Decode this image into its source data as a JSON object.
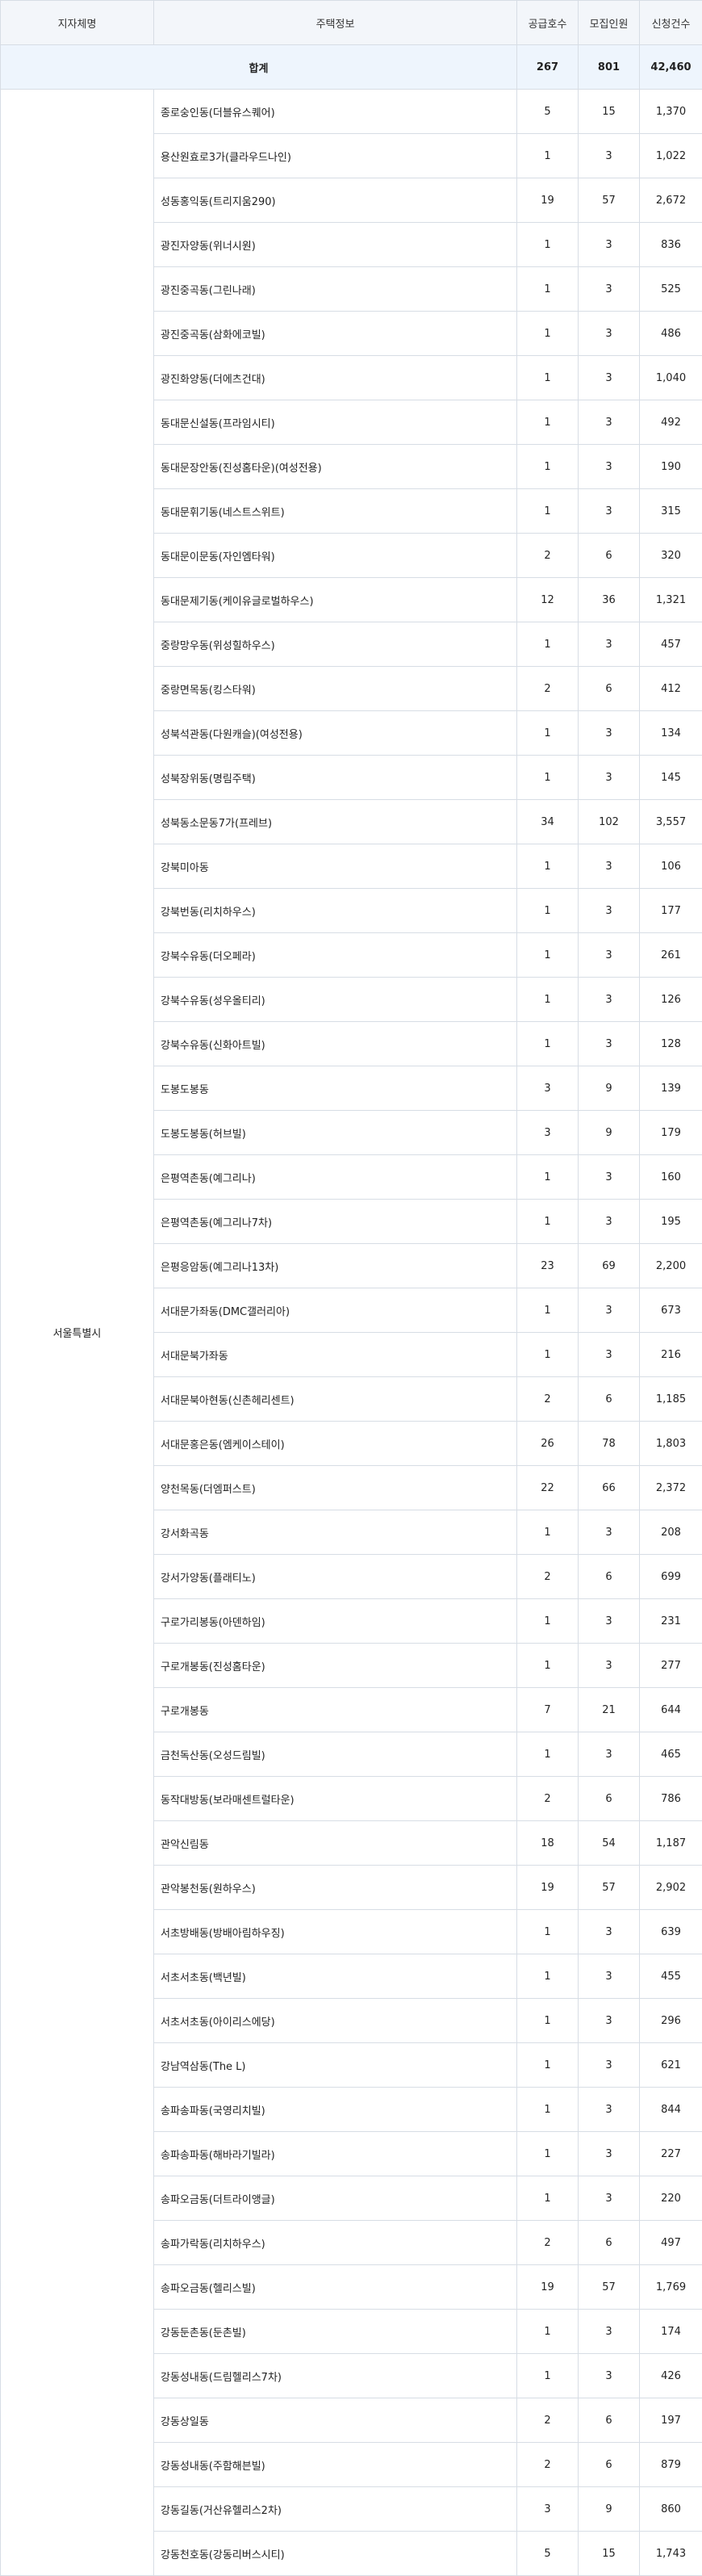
{
  "table": {
    "headers": [
      "지자체명",
      "주택정보",
      "공급호수",
      "모집인원",
      "신청건수"
    ],
    "total": {
      "label": "합계",
      "supply": "267",
      "recruit": "801",
      "applications": "42,460"
    },
    "region": "서울특별시",
    "rows": [
      {
        "name": "종로숭인동(더블유스퀘어)",
        "supply": "5",
        "recruit": "15",
        "applications": "1,370"
      },
      {
        "name": "용산원효로3가(클라우드나인)",
        "supply": "1",
        "recruit": "3",
        "applications": "1,022"
      },
      {
        "name": "성동홍익동(트리지움290)",
        "supply": "19",
        "recruit": "57",
        "applications": "2,672"
      },
      {
        "name": "광진자양동(위너시원)",
        "supply": "1",
        "recruit": "3",
        "applications": "836"
      },
      {
        "name": "광진중곡동(그린나래)",
        "supply": "1",
        "recruit": "3",
        "applications": "525"
      },
      {
        "name": "광진중곡동(삼화에코빌)",
        "supply": "1",
        "recruit": "3",
        "applications": "486"
      },
      {
        "name": "광진화양동(더에츠건대)",
        "supply": "1",
        "recruit": "3",
        "applications": "1,040"
      },
      {
        "name": "동대문신설동(프라임시티)",
        "supply": "1",
        "recruit": "3",
        "applications": "492"
      },
      {
        "name": "동대문장안동(진성홈타운)(여성전용)",
        "supply": "1",
        "recruit": "3",
        "applications": "190"
      },
      {
        "name": "동대문휘기동(네스트스위트)",
        "supply": "1",
        "recruit": "3",
        "applications": "315"
      },
      {
        "name": "동대문이문동(자인엠타워)",
        "supply": "2",
        "recruit": "6",
        "applications": "320"
      },
      {
        "name": "동대문제기동(케이유글로벌하우스)",
        "supply": "12",
        "recruit": "36",
        "applications": "1,321"
      },
      {
        "name": "중랑망우동(위성힐하우스)",
        "supply": "1",
        "recruit": "3",
        "applications": "457"
      },
      {
        "name": "중랑면목동(킹스타워)",
        "supply": "2",
        "recruit": "6",
        "applications": "412"
      },
      {
        "name": "성북석관동(다원캐슬)(여성전용)",
        "supply": "1",
        "recruit": "3",
        "applications": "134"
      },
      {
        "name": "성북장위동(명림주택)",
        "supply": "1",
        "recruit": "3",
        "applications": "145"
      },
      {
        "name": "성북동소문동7가(프레브)",
        "supply": "34",
        "recruit": "102",
        "applications": "3,557"
      },
      {
        "name": "강북미아동",
        "supply": "1",
        "recruit": "3",
        "applications": "106"
      },
      {
        "name": "강북번동(리치하우스)",
        "supply": "1",
        "recruit": "3",
        "applications": "177"
      },
      {
        "name": "강북수유동(더오페라)",
        "supply": "1",
        "recruit": "3",
        "applications": "261"
      },
      {
        "name": "강북수유동(성우올티리)",
        "supply": "1",
        "recruit": "3",
        "applications": "126"
      },
      {
        "name": "강북수유동(신화아트빌)",
        "supply": "1",
        "recruit": "3",
        "applications": "128"
      },
      {
        "name": "도봉도봉동",
        "supply": "3",
        "recruit": "9",
        "applications": "139"
      },
      {
        "name": "도봉도봉동(허브빌)",
        "supply": "3",
        "recruit": "9",
        "applications": "179"
      },
      {
        "name": "은평역촌동(예그리나)",
        "supply": "1",
        "recruit": "3",
        "applications": "160"
      },
      {
        "name": "은평역촌동(예그리나7차)",
        "supply": "1",
        "recruit": "3",
        "applications": "195"
      },
      {
        "name": "은평응암동(예그리나13차)",
        "supply": "23",
        "recruit": "69",
        "applications": "2,200"
      },
      {
        "name": "서대문가좌동(DMC갤러리아)",
        "supply": "1",
        "recruit": "3",
        "applications": "673"
      },
      {
        "name": "서대문북가좌동",
        "supply": "1",
        "recruit": "3",
        "applications": "216"
      },
      {
        "name": "서대문북아현동(신촌헤리센트)",
        "supply": "2",
        "recruit": "6",
        "applications": "1,185"
      },
      {
        "name": "서대문홍은동(엠케이스테이)",
        "supply": "26",
        "recruit": "78",
        "applications": "1,803"
      },
      {
        "name": "양천목동(더엠퍼스트)",
        "supply": "22",
        "recruit": "66",
        "applications": "2,372"
      },
      {
        "name": "강서화곡동",
        "supply": "1",
        "recruit": "3",
        "applications": "208"
      },
      {
        "name": "강서가양동(플래티노)",
        "supply": "2",
        "recruit": "6",
        "applications": "699"
      },
      {
        "name": "구로가리봉동(아덴하임)",
        "supply": "1",
        "recruit": "3",
        "applications": "231"
      },
      {
        "name": "구로개봉동(진성홈타운)",
        "supply": "1",
        "recruit": "3",
        "applications": "277"
      },
      {
        "name": "구로개봉동",
        "supply": "7",
        "recruit": "21",
        "applications": "644"
      },
      {
        "name": "금천독산동(오성드림빌)",
        "supply": "1",
        "recruit": "3",
        "applications": "465"
      },
      {
        "name": "동작대방동(보라매센트럴타운)",
        "supply": "2",
        "recruit": "6",
        "applications": "786"
      },
      {
        "name": "관악신림동",
        "supply": "18",
        "recruit": "54",
        "applications": "1,187"
      },
      {
        "name": "관악봉천동(원하우스)",
        "supply": "19",
        "recruit": "57",
        "applications": "2,902"
      },
      {
        "name": "서초방배동(방배아림하우징)",
        "supply": "1",
        "recruit": "3",
        "applications": "639"
      },
      {
        "name": "서초서초동(백년빌)",
        "supply": "1",
        "recruit": "3",
        "applications": "455"
      },
      {
        "name": "서초서초동(아이리스에당)",
        "supply": "1",
        "recruit": "3",
        "applications": "296"
      },
      {
        "name": "강남역삼동(The L)",
        "supply": "1",
        "recruit": "3",
        "applications": "621"
      },
      {
        "name": "송파송파동(국영리치빌)",
        "supply": "1",
        "recruit": "3",
        "applications": "844"
      },
      {
        "name": "송파송파동(해바라기빌라)",
        "supply": "1",
        "recruit": "3",
        "applications": "227"
      },
      {
        "name": "송파오금동(더트라이앵글)",
        "supply": "1",
        "recruit": "3",
        "applications": "220"
      },
      {
        "name": "송파가락동(리치하우스)",
        "supply": "2",
        "recruit": "6",
        "applications": "497"
      },
      {
        "name": "송파오금동(헬리스빌)",
        "supply": "19",
        "recruit": "57",
        "applications": "1,769"
      },
      {
        "name": "강동둔촌동(둔촌빌)",
        "supply": "1",
        "recruit": "3",
        "applications": "174"
      },
      {
        "name": "강동성내동(드림헬리스7차)",
        "supply": "1",
        "recruit": "3",
        "applications": "426"
      },
      {
        "name": "강동상일동",
        "supply": "2",
        "recruit": "6",
        "applications": "197"
      },
      {
        "name": "강동성내동(주함해븐빌)",
        "supply": "2",
        "recruit": "6",
        "applications": "879"
      },
      {
        "name": "강동길동(거산유헬리스2차)",
        "supply": "3",
        "recruit": "9",
        "applications": "860"
      },
      {
        "name": "강동천호동(강동리버스시티)",
        "supply": "5",
        "recruit": "15",
        "applications": "1,743"
      }
    ]
  }
}
